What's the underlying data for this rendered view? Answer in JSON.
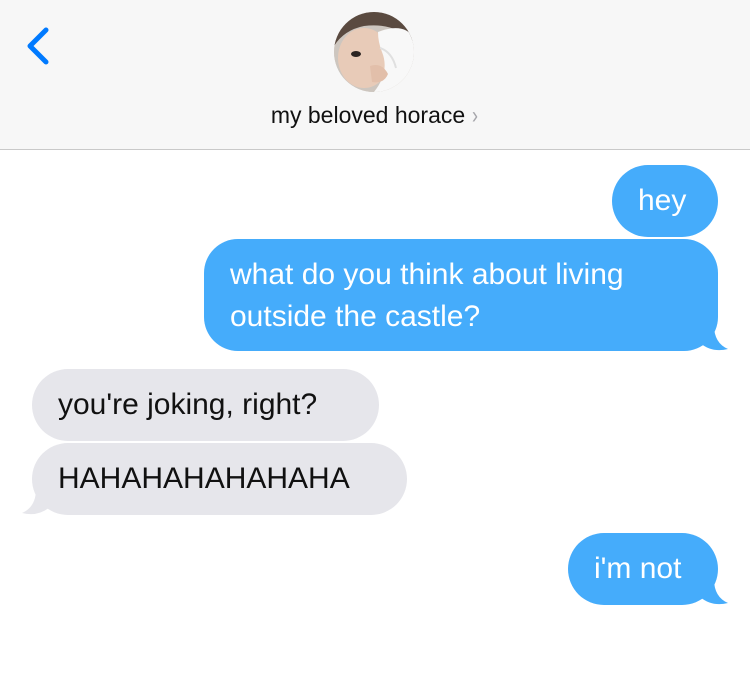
{
  "header": {
    "contact_name": "my beloved horace",
    "chevron": "›",
    "avatar_icon": "contact-photo",
    "back_icon": "chevron-left-icon",
    "accent_color": "#007aff"
  },
  "conversation": {
    "colors": {
      "sent": "#45acfb",
      "received": "#e6e6eb"
    },
    "messages": [
      {
        "direction": "sent",
        "text": "hey"
      },
      {
        "direction": "sent",
        "text": "what do you think about living outside the castle?"
      },
      {
        "direction": "received",
        "text": "you're joking, right?"
      },
      {
        "direction": "received",
        "text": "HAHAHAHAHAHAHA"
      },
      {
        "direction": "sent",
        "text": "i'm not"
      }
    ]
  }
}
